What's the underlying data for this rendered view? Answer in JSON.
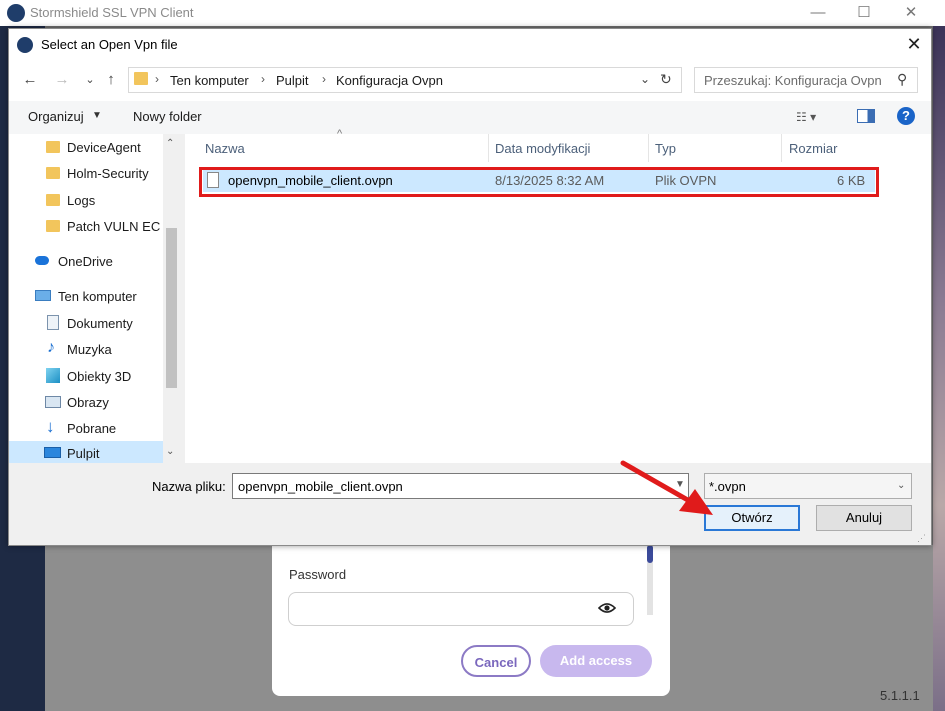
{
  "background_app": {
    "title": "Stormshield SSL VPN Client",
    "window_controls": [
      "—",
      "☐",
      "✕"
    ],
    "login_card": {
      "password_label": "Password",
      "password_value": "",
      "cancel_label": "Cancel",
      "add_access_label": "Add access"
    },
    "version": "5.1.1.1"
  },
  "dialog": {
    "title": "Select an Open Vpn file",
    "close_glyph": "✕",
    "nav": {
      "back": "←",
      "forward": "→",
      "recent": "⌄",
      "up": "↑"
    },
    "breadcrumb": [
      "Ten komputer",
      "Pulpit",
      "Konfiguracja Ovpn"
    ],
    "breadcrumb_separator": "›",
    "search_placeholder": "Przeszukaj: Konfiguracja Ovpn",
    "toolbar": {
      "organize": "Organizuj",
      "new_folder": "Nowy folder",
      "help": "?"
    },
    "sidebar": [
      {
        "label": "DeviceAgent",
        "icon": "folder-icon"
      },
      {
        "label": "Holm-Security",
        "icon": "folder-icon"
      },
      {
        "label": "Logs",
        "icon": "folder-icon"
      },
      {
        "label": "Patch VULN EC I",
        "icon": "folder-icon"
      },
      {
        "label": "OneDrive",
        "icon": "cloud-icon"
      },
      {
        "label": "Ten komputer",
        "icon": "computer-icon"
      },
      {
        "label": "Dokumenty",
        "icon": "documents-icon"
      },
      {
        "label": "Muzyka",
        "icon": "music-icon"
      },
      {
        "label": "Obiekty 3D",
        "icon": "cube-icon"
      },
      {
        "label": "Obrazy",
        "icon": "pictures-icon"
      },
      {
        "label": "Pobrane",
        "icon": "download-icon"
      },
      {
        "label": "Pulpit",
        "icon": "desktop-icon",
        "selected": true
      }
    ],
    "columns": [
      "Nazwa",
      "Data modyfikacji",
      "Typ",
      "Rozmiar"
    ],
    "files": [
      {
        "name": "openvpn_mobile_client.ovpn",
        "modified": "8/13/2025 8:32 AM",
        "type": "Plik OVPN",
        "size": "6 KB"
      }
    ],
    "filename_label": "Nazwa pliku:",
    "filename_value": "openvpn_mobile_client.ovpn",
    "filetype_value": "*.ovpn",
    "open_label": "Otwórz",
    "cancel_label": "Anuluj"
  },
  "colors": {
    "highlight_border": "#e01b1b",
    "selection": "#cce8ff",
    "accent": "#2a78d6",
    "annotation_arrow": "#e01b1b"
  }
}
